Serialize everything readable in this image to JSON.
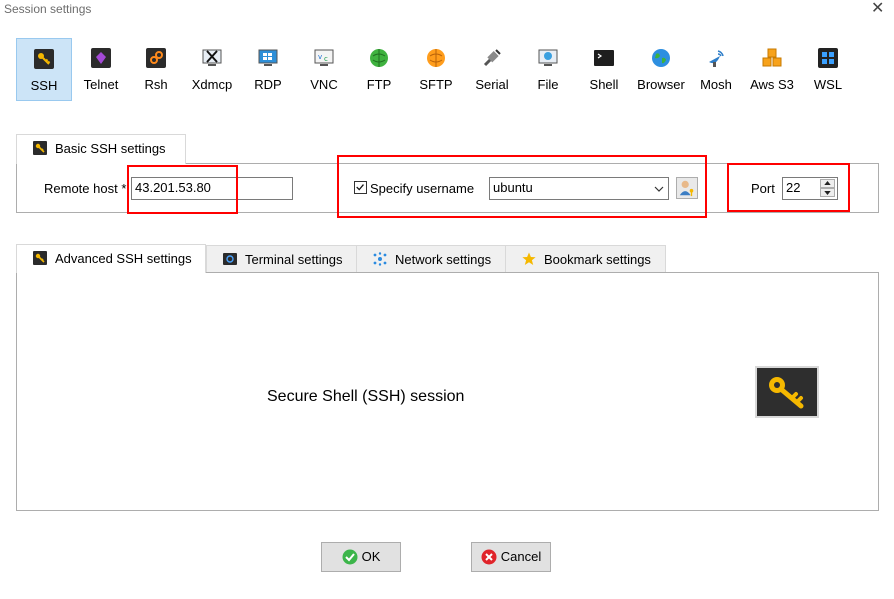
{
  "window": {
    "title": "Session settings",
    "close_glyph": "✕"
  },
  "session_types": [
    {
      "label": "SSH",
      "icon": "ssh-key-icon",
      "selected": true
    },
    {
      "label": "Telnet",
      "icon": "telnet-icon"
    },
    {
      "label": "Rsh",
      "icon": "rsh-icon"
    },
    {
      "label": "Xdmcp",
      "icon": "xdmcp-icon"
    },
    {
      "label": "RDP",
      "icon": "rdp-icon"
    },
    {
      "label": "VNC",
      "icon": "vnc-icon"
    },
    {
      "label": "FTP",
      "icon": "ftp-icon"
    },
    {
      "label": "SFTP",
      "icon": "sftp-icon"
    },
    {
      "label": "Serial",
      "icon": "serial-icon"
    },
    {
      "label": "File",
      "icon": "file-icon"
    },
    {
      "label": "Shell",
      "icon": "shell-icon"
    },
    {
      "label": "Browser",
      "icon": "browser-icon"
    },
    {
      "label": "Mosh",
      "icon": "mosh-icon"
    },
    {
      "label": "Aws S3",
      "icon": "aws-s3-icon"
    },
    {
      "label": "WSL",
      "icon": "wsl-icon"
    }
  ],
  "basic_tab": {
    "label": "Basic SSH settings"
  },
  "basic": {
    "remote_host_label": "Remote host",
    "required_marker": "*",
    "remote_host_value": "43.201.53.80",
    "specify_username_label": "Specify username",
    "specify_username_checked": true,
    "username_value": "ubuntu",
    "port_label": "Port",
    "port_value": "22"
  },
  "advanced_tabs": [
    {
      "label": "Advanced SSH settings",
      "icon": "key-icon"
    },
    {
      "label": "Terminal settings",
      "icon": "terminal-icon"
    },
    {
      "label": "Network settings",
      "icon": "network-icon"
    },
    {
      "label": "Bookmark settings",
      "icon": "star-icon"
    }
  ],
  "main": {
    "description": "Secure Shell (SSH) session"
  },
  "buttons": {
    "ok": "OK",
    "cancel": "Cancel"
  },
  "colors": {
    "highlight": "#ff0000",
    "selected_bg": "#cce4f7",
    "key_yellow": "#f5b800"
  }
}
